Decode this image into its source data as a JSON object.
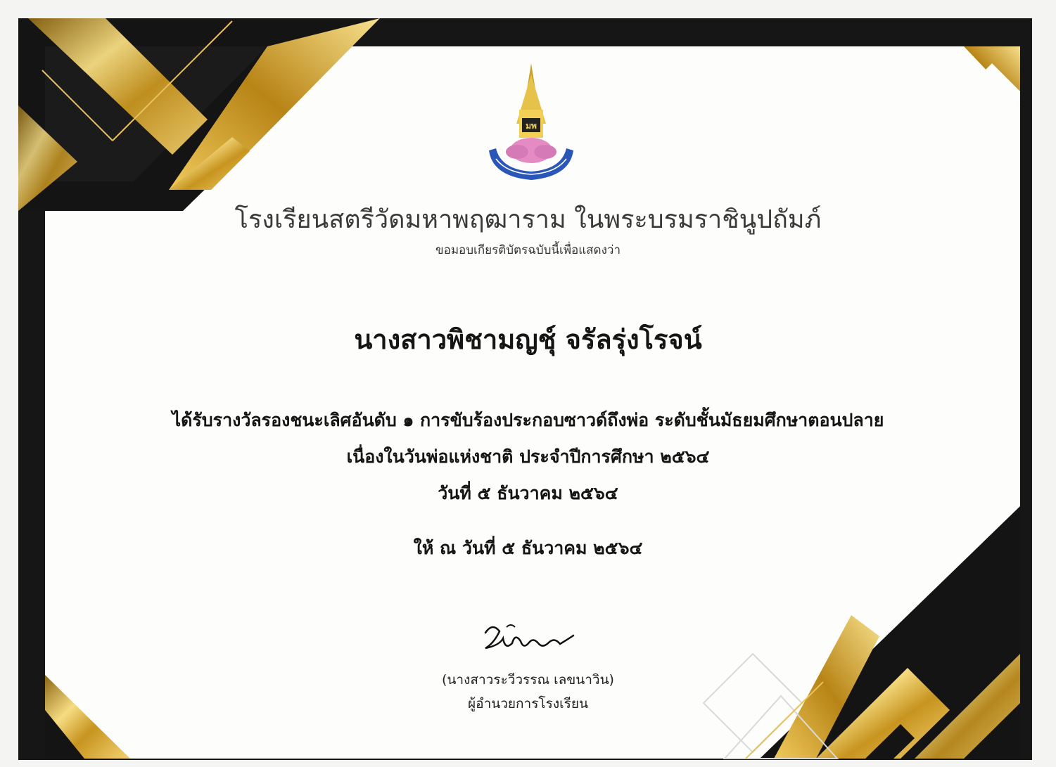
{
  "certificate": {
    "school_name": "โรงเรียนสตรีวัดมหาพฤฒาราม ในพระบรมราชินูปถัมภ์",
    "intro": "ขอมอบเกียรติบัตรฉบับนี้เพื่อแสดงว่า",
    "recipient": "นางสาวพิชามญชุ์ จรัลรุ่งโรจน์",
    "award_line1": "ได้รับรางวัลรองชนะเลิศอันดับ ๑ การขับร้องประกอบซาวด์ถึงพ่อ ระดับชั้นมัธยมศึกษาตอนปลาย",
    "award_line2": "เนื่องในวันพ่อแห่งชาติ ประจำปีการศึกษา ๒๕๖๔",
    "award_line3": "วันที่ ๕ ธันวาคม ๒๕๖๔",
    "given_date": "ให้ ณ วันที่ ๕ ธันวาคม ๒๕๖๔",
    "signer_name": "(นางสาวระวีวรรณ  เลขนาวิน)",
    "signer_title": "ผู้อำนวยการโรงเรียน",
    "logo_text": "มพ"
  },
  "colors": {
    "frame": "#161616",
    "gold": "#d4a72c",
    "gold_light": "#f3d77a",
    "logo_blue": "#2a56b8",
    "logo_pink": "#e58bc4"
  }
}
